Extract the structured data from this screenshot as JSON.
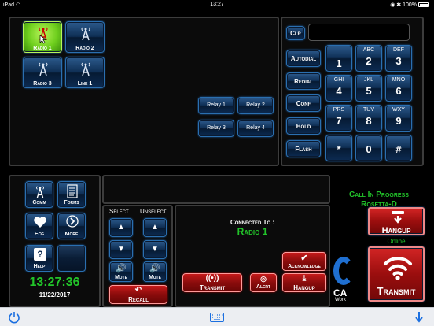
{
  "status_bar": {
    "device": "iPad",
    "time": "13:27",
    "battery": "100%"
  },
  "radios": [
    {
      "label": "Radio 1",
      "active": true
    },
    {
      "label": "Radio 2",
      "active": false
    },
    {
      "label": "Radio 3",
      "active": false
    },
    {
      "label": "Line 1",
      "active": false
    }
  ],
  "relays": [
    "Relay 1",
    "Relay 2",
    "Relay 3",
    "Relay 4"
  ],
  "dialer": {
    "clear_label": "Clr",
    "display_value": "",
    "side_buttons": [
      "Autodial",
      "Redial",
      "Conf",
      "Hold",
      "Flash"
    ],
    "keys": [
      {
        "num": "1",
        "letters": ""
      },
      {
        "num": "2",
        "letters": "ABC"
      },
      {
        "num": "3",
        "letters": "DEF"
      },
      {
        "num": "4",
        "letters": "GHI"
      },
      {
        "num": "5",
        "letters": "JKL"
      },
      {
        "num": "6",
        "letters": "MNO"
      },
      {
        "num": "7",
        "letters": "PRS"
      },
      {
        "num": "8",
        "letters": "TUV"
      },
      {
        "num": "9",
        "letters": "WXY"
      },
      {
        "num": "*",
        "letters": ""
      },
      {
        "num": "0",
        "letters": ""
      },
      {
        "num": "#",
        "letters": ""
      }
    ]
  },
  "nav": {
    "buttons": [
      "Comm",
      "Forms",
      "Ecg",
      "More",
      "Help",
      ""
    ],
    "clock": "13:27:36",
    "date": "11/22/2017"
  },
  "audio": {
    "select_label": "Select",
    "unselect_label": "Unselect",
    "mute_label": "Mute",
    "recall_label": "Recall"
  },
  "connection": {
    "connected_label": "Connected To :",
    "connected_value": "Radio 1",
    "transmit_label": "Transmit",
    "alert_label": "Alert",
    "acknowledge_label": "Acknowledge",
    "hangup_label": "Hangup"
  },
  "call_status": {
    "line1": "Call In Progress",
    "line2": "Rosetta-D",
    "hangup_label": "Hangup",
    "online_label": "Online",
    "transmit_label": "Transmit",
    "logo_partial": "CA",
    "logo_sub": "Work"
  },
  "colors": {
    "accent_blue": "#2a6fb0",
    "active_green": "#6fcf1e",
    "status_green": "#22c42a",
    "danger_red": "#9b0e0e"
  }
}
